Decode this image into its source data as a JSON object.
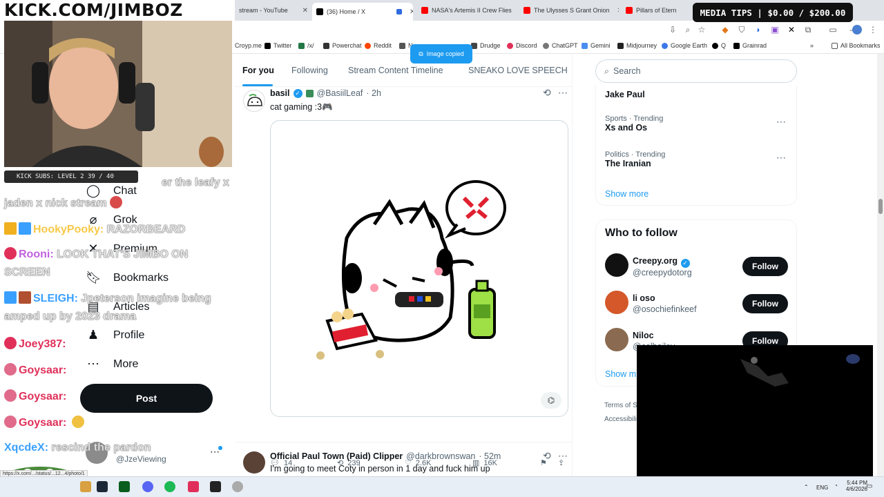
{
  "overlay": {
    "kick_banner": "KICK.COM/JIMBOZ",
    "media_tips": "MEDIA TIPS | $0.00 / $200.00",
    "kick_subs": "KICK SUBS: LEVEL 2 39 / 40"
  },
  "browser": {
    "tabs": [
      {
        "label": "stream - YouTube",
        "color": "#ff0000"
      },
      {
        "label": "(36) Home / X",
        "color": "#000000"
      },
      {
        "label": "NASA's Artemis II Crew Flies",
        "color": "#ff0000"
      },
      {
        "label": "The Ulysses S Grant Onion",
        "color": "#ff0000"
      },
      {
        "label": "Pillars of Etern",
        "color": "#ff0000"
      }
    ],
    "bookmarks": [
      "Croyp.me",
      "Twitter",
      "/x/",
      "Powerchat",
      "Reddit",
      "N",
      "Drudge",
      "Discord",
      "ChatGPT",
      "Gemini",
      "Midjourney",
      "Google Earth",
      "Q",
      "Grainrad"
    ],
    "all_bookmarks": "All Bookmarks",
    "toast": "Image copied"
  },
  "nav": {
    "items": [
      "Chat",
      "Grok",
      "Premium",
      "Bookmarks",
      "Articles",
      "Profile",
      "More"
    ],
    "post": "Post",
    "account_handle": "@JzeViewing",
    "status_url": "https://x.com/.../status/...12...4/photo/1"
  },
  "feed": {
    "tabs": [
      "For you",
      "Following",
      "Stream Content Timeline",
      "SNEAKO LOVE SPEECH"
    ],
    "tweet1": {
      "name": "basil",
      "handle": "@BasiilLeaf",
      "time": "· 2h",
      "text": "cat gaming :3🎮",
      "replies": "14",
      "reposts": "239",
      "likes": "2.6K",
      "views": "16K"
    },
    "tweet2": {
      "name": "Official Paul Town (Paid) Clipper",
      "handle": "@darkbrownswan",
      "time": "· 52m",
      "text": "I'm going to meet Coty in person in 1 day and fuck him up"
    }
  },
  "sidebar": {
    "search_placeholder": "Search",
    "trends": [
      {
        "meta": "",
        "name": "Jake Paul"
      },
      {
        "meta": "Sports · Trending",
        "name": "Xs and Os"
      },
      {
        "meta": "Politics · Trending",
        "name": "The Iranian"
      }
    ],
    "show_more": "Show more",
    "who_to_follow": "Who to follow",
    "follow_suggestions": [
      {
        "name": "Creepy.org",
        "handle": "@creepydotorg",
        "verified": true
      },
      {
        "name": "li oso",
        "handle": "@osochiefinkeef",
        "verified": false
      },
      {
        "name": "Niloc",
        "handle": "@colbailey",
        "verified": false
      }
    ],
    "follow_label": "Follow",
    "show_more_2": "Show m",
    "terms": "Terms of S",
    "accessibility": "Accessibili"
  },
  "chat": [
    {
      "user": "",
      "msg": "er the leafy x",
      "color": "#ffffff"
    },
    {
      "user": "",
      "msg": "jaden x nick stream",
      "color": "#ffffff"
    },
    {
      "user": "HookyPooky:",
      "msg": "RAZORBEARD",
      "color": "#f7c948"
    },
    {
      "user": "Rooni:",
      "msg": "LOOK THAT'S JIMBO ON",
      "color": "#c060e0"
    },
    {
      "user": "",
      "msg": "SCREEN",
      "color": "#ffffff"
    },
    {
      "user": "SLEIGH:",
      "msg": "Jpeterson imagine being",
      "color": "#3aa0ff"
    },
    {
      "user": "",
      "msg": "amped up by 2023 drama",
      "color": "#ffffff"
    },
    {
      "user": "Joey387:",
      "msg": "",
      "color": "#e0305a"
    },
    {
      "user": "Goysaar:",
      "msg": "",
      "color": "#e0305a"
    },
    {
      "user": "Goysaar:",
      "msg": "",
      "color": "#e0305a"
    },
    {
      "user": "Goysaar:",
      "msg": "",
      "color": "#e0305a"
    },
    {
      "user": "XqcdeX:",
      "msg": "rescind the pardon",
      "color": "#3aa0ff"
    }
  ],
  "taskbar": {
    "lang": "ENG",
    "time": "5:44 PM",
    "date": "4/6/2026"
  }
}
